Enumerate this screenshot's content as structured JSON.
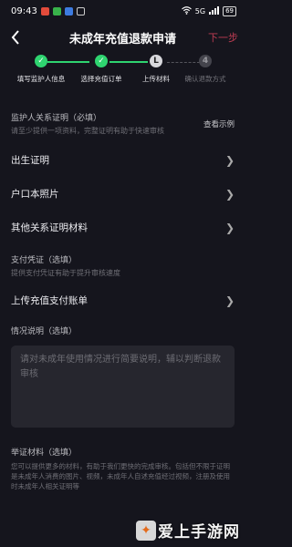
{
  "status": {
    "time": "09:43",
    "network": "5G",
    "battery": "69"
  },
  "header": {
    "title": "未成年充值退款申请",
    "next_label": "下一步"
  },
  "steps": [
    {
      "label": "填写监护人信息",
      "state": "done"
    },
    {
      "label": "选择充值订单",
      "state": "done"
    },
    {
      "label": "上传材料",
      "state": "current",
      "number": "L"
    },
    {
      "label": "确认退款方式",
      "state": "todo",
      "number": "4"
    }
  ],
  "relation": {
    "title": "监护人关系证明（必填）",
    "subtitle": "请至少提供一项资料，完整证明有助于快速审核",
    "example_link": "查看示例",
    "items": [
      "出生证明",
      "户口本照片",
      "其他关系证明材料"
    ]
  },
  "payment": {
    "title": "支付凭证（选填）",
    "subtitle": "提供支付凭证有助于提升审核速度",
    "item": "上传充值支付账单"
  },
  "situation": {
    "title": "情况说明（选填）",
    "placeholder": "请对未成年使用情况进行简要说明，辅以判断退款审核"
  },
  "evidence": {
    "title": "举证材料（选填）",
    "body": "您可以提供更多的材料，有助于我们更快的完成审核。包括但不限于证明是未成年人消费的图片、视频，未成年人自述充值经过视频，注册及使用时未成年人相关证明等"
  },
  "watermark": {
    "text": "爱上手游网"
  },
  "colors": {
    "background": "#15151d",
    "done": "#2fd470",
    "accent_next": "#bd3c52"
  }
}
